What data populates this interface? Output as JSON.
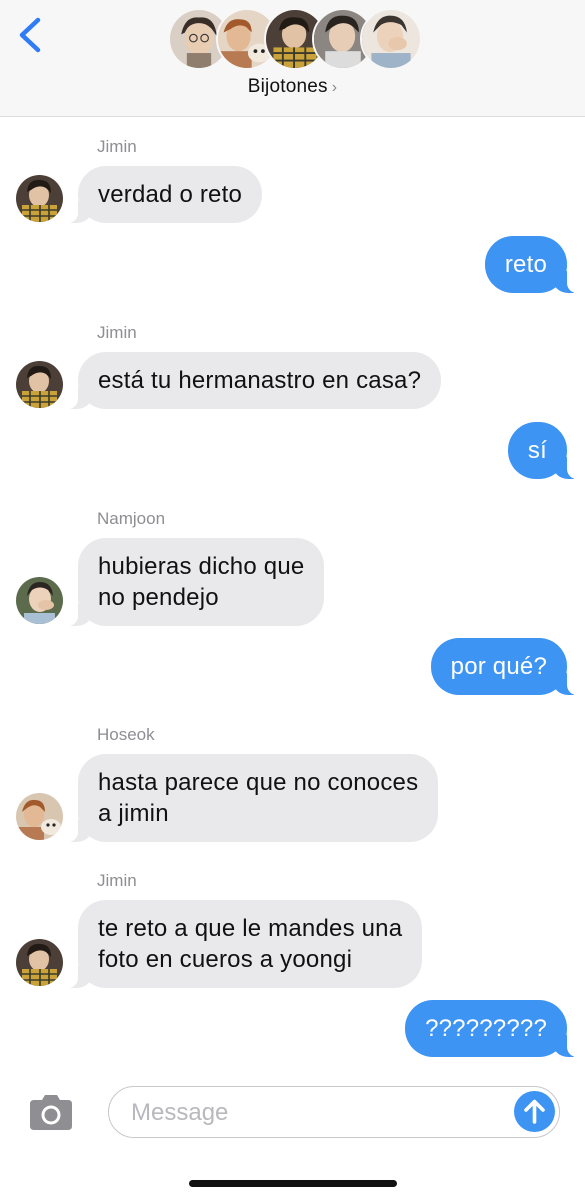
{
  "header": {
    "group_name": "Bijotones",
    "chevron": "›",
    "back_icon": "chevron-left-icon",
    "member_avatars": [
      {
        "name": "avatar-1",
        "tone": "#8f7d6e"
      },
      {
        "name": "avatar-2",
        "tone": "#b87a52"
      },
      {
        "name": "avatar-3",
        "tone": "#5a4a3a"
      },
      {
        "name": "avatar-4",
        "tone": "#6f6a68"
      },
      {
        "name": "avatar-5",
        "tone": "#c9b9ad"
      }
    ]
  },
  "messages": [
    {
      "type": "in",
      "sender": "Jimin",
      "text": "verdad o reto"
    },
    {
      "type": "out",
      "text": "reto"
    },
    {
      "type": "in",
      "sender": "Jimin",
      "text": "está tu hermanastro en casa?"
    },
    {
      "type": "out",
      "text": "sí"
    },
    {
      "type": "in",
      "sender": "Namjoon",
      "text": "hubieras dicho que\nno pendejo"
    },
    {
      "type": "out",
      "text": "por qué?"
    },
    {
      "type": "in",
      "sender": "Hoseok",
      "text": "hasta parece que no conoces\na jimin"
    },
    {
      "type": "in",
      "sender": "Jimin",
      "text": "te reto a que le mandes una\nfoto en cueros a yoongi"
    },
    {
      "type": "out",
      "text": "?????????"
    }
  ],
  "composer": {
    "placeholder": "Message",
    "camera_icon": "camera-icon",
    "send_icon": "arrow-up-icon"
  },
  "colors": {
    "outgoing": "#3e94f3",
    "incoming": "#e9e9eb",
    "accent": "#2f7cf6"
  }
}
